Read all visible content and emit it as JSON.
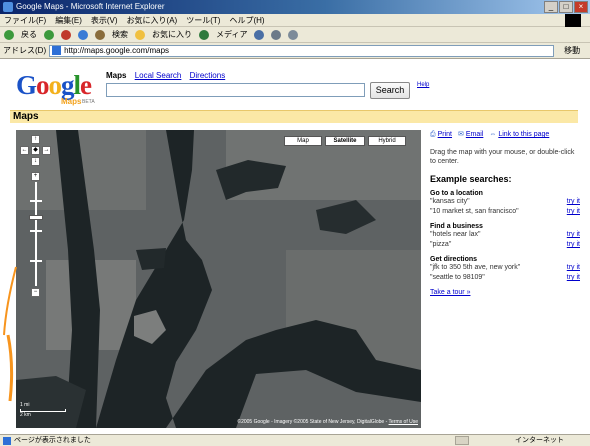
{
  "window": {
    "title": "Google Maps - Microsoft Internet Explorer",
    "buttons": {
      "minimize": "_",
      "maximize": "□",
      "close": "×"
    }
  },
  "menubar": [
    "ファイル(F)",
    "編集(E)",
    "表示(V)",
    "お気に入り(A)",
    "ツール(T)",
    "ヘルプ(H)"
  ],
  "toolbar": {
    "back": "戻る",
    "search": "検索",
    "favorites": "お気に入り",
    "media": "メディア"
  },
  "address": {
    "label": "アドレス(D)",
    "url": "http://maps.google.com/maps",
    "go": "移動"
  },
  "header": {
    "logo": {
      "g1": "G",
      "o1": "o",
      "o2": "o",
      "g2": "g",
      "l": "l",
      "e": "e"
    },
    "logo_sub": "Maps",
    "logo_beta": "BETA",
    "tabs": {
      "current": "Maps",
      "local": "Local Search",
      "directions": "Directions"
    },
    "search_value": "",
    "search_button": "Search",
    "help": "Help"
  },
  "section_title": "Maps",
  "map": {
    "types": {
      "map": "Map",
      "satellite": "Satellite",
      "hybrid": "Hybrid"
    },
    "active_type": "satellite",
    "pan": {
      "up": "↑",
      "left": "←",
      "center": "◆",
      "right": "→",
      "down": "↓"
    },
    "zoom": {
      "in": "+",
      "out": "−",
      "level_fraction": 0.33
    },
    "scale": "1 mi",
    "scale_km": "2 km",
    "copyright": "©2005 Google - Imagery ©2005 State of New Jersey, DigitalGlobe - ",
    "terms": "Terms of Use",
    "colors": {
      "water": "#1d2426",
      "land": "#5e6263",
      "urban": "#7a7c7b",
      "annotation": "#f7941d"
    }
  },
  "side": {
    "links": {
      "print": "Print",
      "email": "Email",
      "link": "Link to this page"
    },
    "hint": "Drag the map with your mouse, or double-click to center.",
    "heading": "Example searches:",
    "groups": [
      {
        "title": "Go to a location",
        "items": [
          {
            "text": "\"kansas city\"",
            "action": "try it"
          },
          {
            "text": "\"10 market st, san francisco\"",
            "action": "try it"
          }
        ]
      },
      {
        "title": "Find a business",
        "items": [
          {
            "text": "\"hotels near lax\"",
            "action": "try it"
          },
          {
            "text": "\"pizza\"",
            "action": "try it"
          }
        ]
      },
      {
        "title": "Get directions",
        "items": [
          {
            "text": "\"jfk to 350 5th ave, new york\"",
            "action": "try it"
          },
          {
            "text": "\"seattle to 98109\"",
            "action": "try it"
          }
        ]
      }
    ],
    "tour": "Take a tour »"
  },
  "status": {
    "text": "ページが表示されました",
    "zone": "インターネット"
  }
}
